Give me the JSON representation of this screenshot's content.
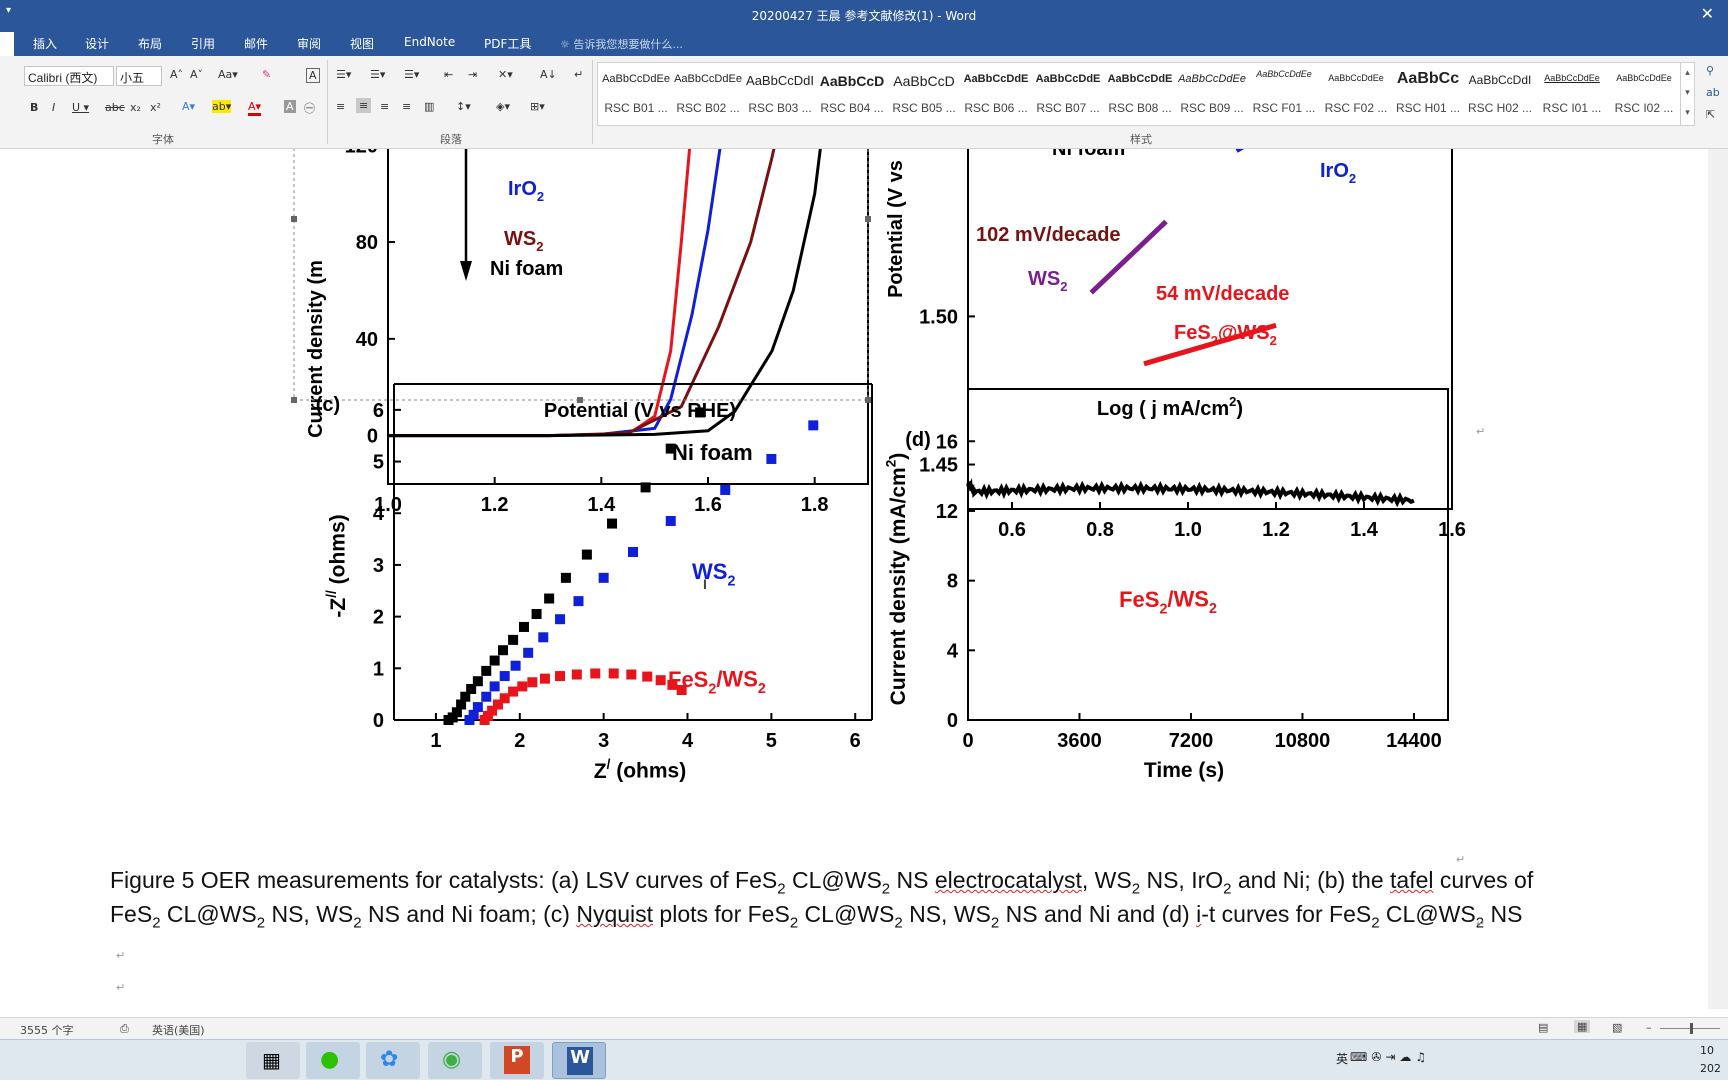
{
  "window": {
    "title": "20200427 王晨 参考文献修改(1) - Word",
    "close_symbol": "✕"
  },
  "ribbon_tabs": [
    "插入",
    "设计",
    "布局",
    "引用",
    "邮件",
    "审阅",
    "视图",
    "EndNote",
    "PDF工具"
  ],
  "tell_me": "告诉我您想要做什么...",
  "font": {
    "name": "Calibri (西文)",
    "size": "小五"
  },
  "groups": {
    "font": "字体",
    "paragraph": "段落",
    "styles": "样式"
  },
  "styles": [
    {
      "sample": "AaBbCcDdEe",
      "name": "RSC B01 ..."
    },
    {
      "sample": "AaBbCcDdEe",
      "name": "RSC B02 ..."
    },
    {
      "sample": "AaBbCcDdI",
      "name": "RSC B03 ..."
    },
    {
      "sample": "AaBbCcD",
      "name": "RSC B04 ..."
    },
    {
      "sample": "AaBbCcD",
      "name": "RSC B05 ..."
    },
    {
      "sample": "AaBbCcDdE",
      "name": "RSC B06 ..."
    },
    {
      "sample": "AaBbCcDdE",
      "name": "RSC B07 ..."
    },
    {
      "sample": "AaBbCcDdE",
      "name": "RSC B08 ..."
    },
    {
      "sample": "AaBbCcDdEe",
      "name": "RSC B09 ..."
    },
    {
      "sample": "AaBbCcDdEe",
      "name": "RSC F01 ..."
    },
    {
      "sample": "AaBbCcDdEe",
      "name": "RSC F02 ..."
    },
    {
      "sample": "AaBbCc",
      "name": "RSC H01 ..."
    },
    {
      "sample": "AaBbCcDdI",
      "name": "RSC H02 ..."
    },
    {
      "sample": "AaBbCcDdEe",
      "name": "RSC I01 ..."
    },
    {
      "sample": "AaBbCcDdEe",
      "name": "RSC I02 ..."
    }
  ],
  "caption": {
    "line1_a": "Figure 5 OER measurements for catalysts: (a) LSV curves of FeS",
    "line1_b": " CL@WS",
    "line1_c": " NS ",
    "line1_d": "electrocatalyst",
    "line1_e": ", WS",
    "line1_f": " NS, IrO",
    "line1_g": " and Ni; (b) the ",
    "line1_h": "tafel",
    "line1_i": " curves of",
    "line2_a": "FeS",
    "line2_b": " CL@WS",
    "line2_c": " NS, WS",
    "line2_d": " NS and Ni foam; (c) ",
    "line2_e": "Nyquist",
    "line2_f": " plots for FeS",
    "line2_g": " CL@WS",
    "line2_h": " NS, WS",
    "line2_i": " NS and Ni and (d) ",
    "line2_j": "i",
    "line2_k": "-t curves for FeS",
    "line2_l": " CL@WS",
    "line2_m": " NS",
    "sub": "2"
  },
  "status": {
    "word_count": "3555 个字",
    "language": "英语(美国)"
  },
  "colors": {
    "titlebar": "#2b579a",
    "black": "#000000",
    "red": "#e8141b",
    "blue": "#1020d8",
    "darkred": "#7a1010",
    "purple": "#7a1f8c"
  },
  "chart_data": [
    {
      "id": "a",
      "type": "line",
      "xlabel": "Potential (V vs RHE)",
      "ylabel": "Current density (m",
      "x_ticks": [
        "1.0",
        "1.2",
        "1.4",
        "1.6",
        "1.8"
      ],
      "y_ticks": [
        "0",
        "40",
        "80",
        "120"
      ],
      "xlim": [
        1.0,
        1.9
      ],
      "ylim": [
        -20,
        135
      ],
      "legend": [
        {
          "text": "IrO",
          "sub": "2",
          "color": "blue"
        },
        {
          "text": "WS",
          "sub": "2",
          "color": "darkred"
        },
        {
          "text": "Ni foam",
          "sub": "",
          "color": "black"
        }
      ],
      "series": [
        {
          "color": "red",
          "points": [
            [
              1.0,
              0
            ],
            [
              1.3,
              0
            ],
            [
              1.4,
              0.5
            ],
            [
              1.46,
              2
            ],
            [
              1.5,
              8
            ],
            [
              1.53,
              35
            ],
            [
              1.55,
              80
            ],
            [
              1.57,
              130
            ]
          ]
        },
        {
          "color": "blue",
          "points": [
            [
              1.0,
              0
            ],
            [
              1.3,
              0
            ],
            [
              1.4,
              0.5
            ],
            [
              1.5,
              3
            ],
            [
              1.53,
              15
            ],
            [
              1.57,
              50
            ],
            [
              1.6,
              85
            ],
            [
              1.63,
              130
            ]
          ]
        },
        {
          "color": "darkred",
          "points": [
            [
              1.0,
              0
            ],
            [
              1.3,
              0
            ],
            [
              1.45,
              1
            ],
            [
              1.55,
              12
            ],
            [
              1.62,
              45
            ],
            [
              1.68,
              80
            ],
            [
              1.72,
              115
            ],
            [
              1.74,
              135
            ]
          ]
        },
        {
          "color": "black",
          "points": [
            [
              1.0,
              0
            ],
            [
              1.3,
              0
            ],
            [
              1.5,
              0.5
            ],
            [
              1.6,
              2
            ],
            [
              1.65,
              10
            ],
            [
              1.72,
              35
            ],
            [
              1.76,
              60
            ],
            [
              1.8,
              100
            ],
            [
              1.82,
              135
            ]
          ]
        }
      ]
    },
    {
      "id": "b",
      "type": "line",
      "xlabel": "Log ( j mA/cm",
      "xlabel_sup": "2",
      "xlabel_end": ")",
      "ylabel": "Potential (V vs",
      "x_ticks": [
        "0.6",
        "0.8",
        "1.0",
        "1.2",
        "1.4",
        "1.6"
      ],
      "y_ticks": [
        "1.45",
        "1.50"
      ],
      "xlim": [
        0.5,
        1.6
      ],
      "ylim": [
        1.435,
        1.57
      ],
      "annotations": [
        {
          "text": "102 mV/decade",
          "color": "darkred"
        },
        {
          "text": "54 mV/decade",
          "color": "red"
        },
        {
          "text": "IrO",
          "sub": "2",
          "color": "blue"
        },
        {
          "text": "WS",
          "sub": "2",
          "color": "purple"
        },
        {
          "text": "FeS",
          "sub": "2",
          "after": "@WS",
          "sub2": "2",
          "color": "red"
        },
        {
          "text": "Ni foam",
          "color": "black"
        }
      ],
      "series": [
        {
          "color": "purple",
          "points": [
            [
              0.78,
              1.508
            ],
            [
              0.95,
              1.532
            ]
          ]
        },
        {
          "color": "red",
          "points": [
            [
              0.9,
              1.484
            ],
            [
              1.2,
              1.497
            ]
          ]
        },
        {
          "color": "blue",
          "points": [
            [
              1.11,
              1.556
            ],
            [
              1.22,
              1.565
            ]
          ]
        }
      ]
    },
    {
      "id": "c",
      "type": "scatter",
      "xlabel": "Z",
      "xlabel_sup": "/",
      "xlabel_end": " (ohms)",
      "ylabel": "-Z",
      "ylabel_sup": "//",
      "ylabel_end": " (ohms)",
      "x_ticks": [
        "1",
        "2",
        "3",
        "4",
        "5",
        "6"
      ],
      "y_ticks": [
        "0",
        "1",
        "2",
        "3",
        "4",
        "5",
        "6"
      ],
      "xlim": [
        0.5,
        6.2
      ],
      "ylim": [
        0,
        6.5
      ],
      "series": [
        {
          "name": "Ni foam",
          "color": "black",
          "points": [
            [
              1.15,
              0
            ],
            [
              1.2,
              0.05
            ],
            [
              1.25,
              0.15
            ],
            [
              1.3,
              0.3
            ],
            [
              1.35,
              0.45
            ],
            [
              1.42,
              0.6
            ],
            [
              1.5,
              0.75
            ],
            [
              1.6,
              0.95
            ],
            [
              1.7,
              1.15
            ],
            [
              1.8,
              1.35
            ],
            [
              1.92,
              1.55
            ],
            [
              2.05,
              1.8
            ],
            [
              2.2,
              2.05
            ],
            [
              2.35,
              2.35
            ],
            [
              2.55,
              2.75
            ],
            [
              2.8,
              3.2
            ],
            [
              3.1,
              3.8
            ],
            [
              3.5,
              4.5
            ],
            [
              3.8,
              5.25
            ],
            [
              4.15,
              5.95
            ]
          ]
        },
        {
          "name": "WS",
          "name_sub": "2",
          "color": "blue",
          "points": [
            [
              1.4,
              0
            ],
            [
              1.45,
              0.1
            ],
            [
              1.5,
              0.25
            ],
            [
              1.6,
              0.45
            ],
            [
              1.7,
              0.65
            ],
            [
              1.82,
              0.85
            ],
            [
              1.95,
              1.05
            ],
            [
              2.1,
              1.3
            ],
            [
              2.28,
              1.6
            ],
            [
              2.48,
              1.95
            ],
            [
              2.7,
              2.3
            ],
            [
              3.0,
              2.75
            ],
            [
              3.35,
              3.25
            ],
            [
              3.8,
              3.85
            ],
            [
              4.45,
              4.45
            ],
            [
              5.0,
              5.05
            ],
            [
              5.5,
              5.7
            ]
          ]
        },
        {
          "name": "FeS",
          "name_sub": "2",
          "name_after": "/WS",
          "name_sub2": "2",
          "color": "red",
          "points": [
            [
              1.58,
              0
            ],
            [
              1.62,
              0.08
            ],
            [
              1.67,
              0.18
            ],
            [
              1.74,
              0.3
            ],
            [
              1.82,
              0.42
            ],
            [
              1.92,
              0.55
            ],
            [
              2.03,
              0.65
            ],
            [
              2.15,
              0.73
            ],
            [
              2.3,
              0.8
            ],
            [
              2.48,
              0.85
            ],
            [
              2.68,
              0.88
            ],
            [
              2.9,
              0.9
            ],
            [
              3.12,
              0.9
            ],
            [
              3.33,
              0.88
            ],
            [
              3.52,
              0.84
            ],
            [
              3.68,
              0.77
            ],
            [
              3.82,
              0.68
            ],
            [
              3.93,
              0.58
            ]
          ]
        }
      ]
    },
    {
      "id": "d",
      "type": "line",
      "xlabel": "Time (s)",
      "ylabel": "Current density (mA/cm",
      "ylabel_sup": "2",
      "ylabel_end": ")",
      "x_ticks": [
        "0",
        "3600",
        "7200",
        "10800",
        "14400"
      ],
      "y_ticks": [
        "0",
        "4",
        "8",
        "12",
        "16"
      ],
      "xlim": [
        0,
        15500
      ],
      "ylim": [
        0,
        19
      ],
      "series": [
        {
          "name": "FeS",
          "name_sub": "2",
          "name_after": "/WS",
          "name_sub2": "2",
          "color": "black",
          "points": [
            [
              0,
              13.6
            ],
            [
              200,
              13.1
            ],
            [
              1800,
              13.2
            ],
            [
              3600,
              13.3
            ],
            [
              5400,
              13.3
            ],
            [
              7200,
              13.25
            ],
            [
              9000,
              13.15
            ],
            [
              10800,
              13.0
            ],
            [
              12600,
              12.8
            ],
            [
              14400,
              12.6
            ]
          ]
        }
      ]
    }
  ],
  "misc": {
    "page_right_char": "登",
    "taskbar_time": "10",
    "taskbar_date": "202",
    "ime": "英"
  }
}
